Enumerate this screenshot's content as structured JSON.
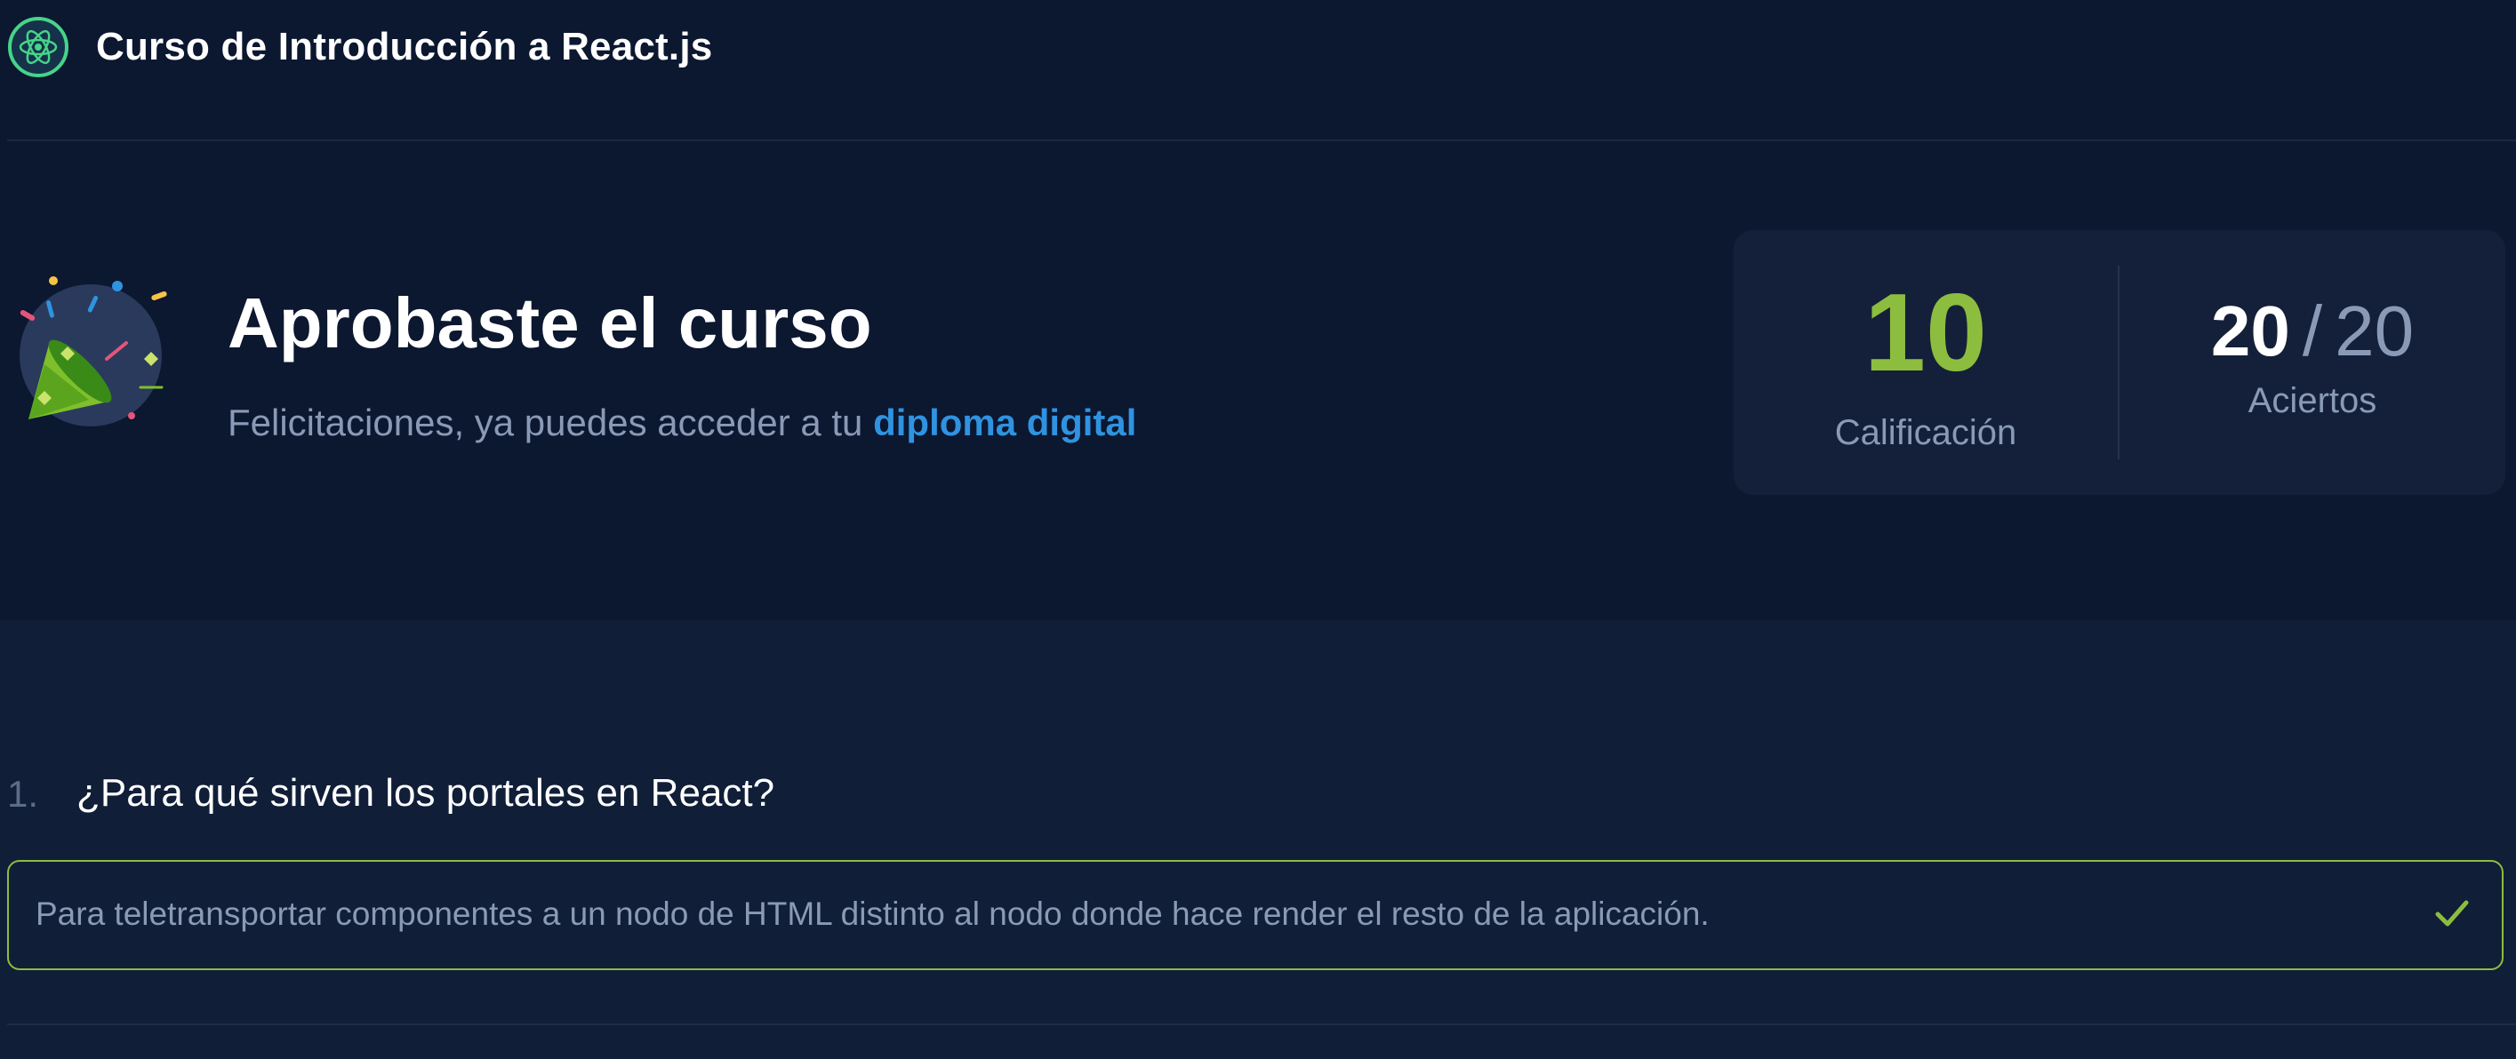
{
  "header": {
    "course_title": "Curso de Introducción a React.js",
    "logo_icon": "react-atom-icon"
  },
  "hero": {
    "title": "Aprobaste el curso",
    "subtitle_prefix": "Felicitaciones, ya puedes acceder a tu ",
    "diploma_link": "diploma digital",
    "illustration": "party-popper-icon"
  },
  "score": {
    "grade_value": "10",
    "grade_label": "Calificación",
    "hits_correct": "20",
    "hits_separator": "/",
    "hits_total": "20",
    "hits_label": "Aciertos"
  },
  "questions": [
    {
      "number": "1.",
      "text": "¿Para qué sirven los portales en React?",
      "answer": "Para teletransportar componentes a un nodo de HTML distinto al nodo donde hace render el resto de la aplicación.",
      "status_icon": "check-icon"
    }
  ],
  "colors": {
    "background": "#0c1730",
    "panel": "#142039",
    "success": "#8dbd3f",
    "link": "#2f93e0",
    "muted_text": "#8a9ab6"
  }
}
